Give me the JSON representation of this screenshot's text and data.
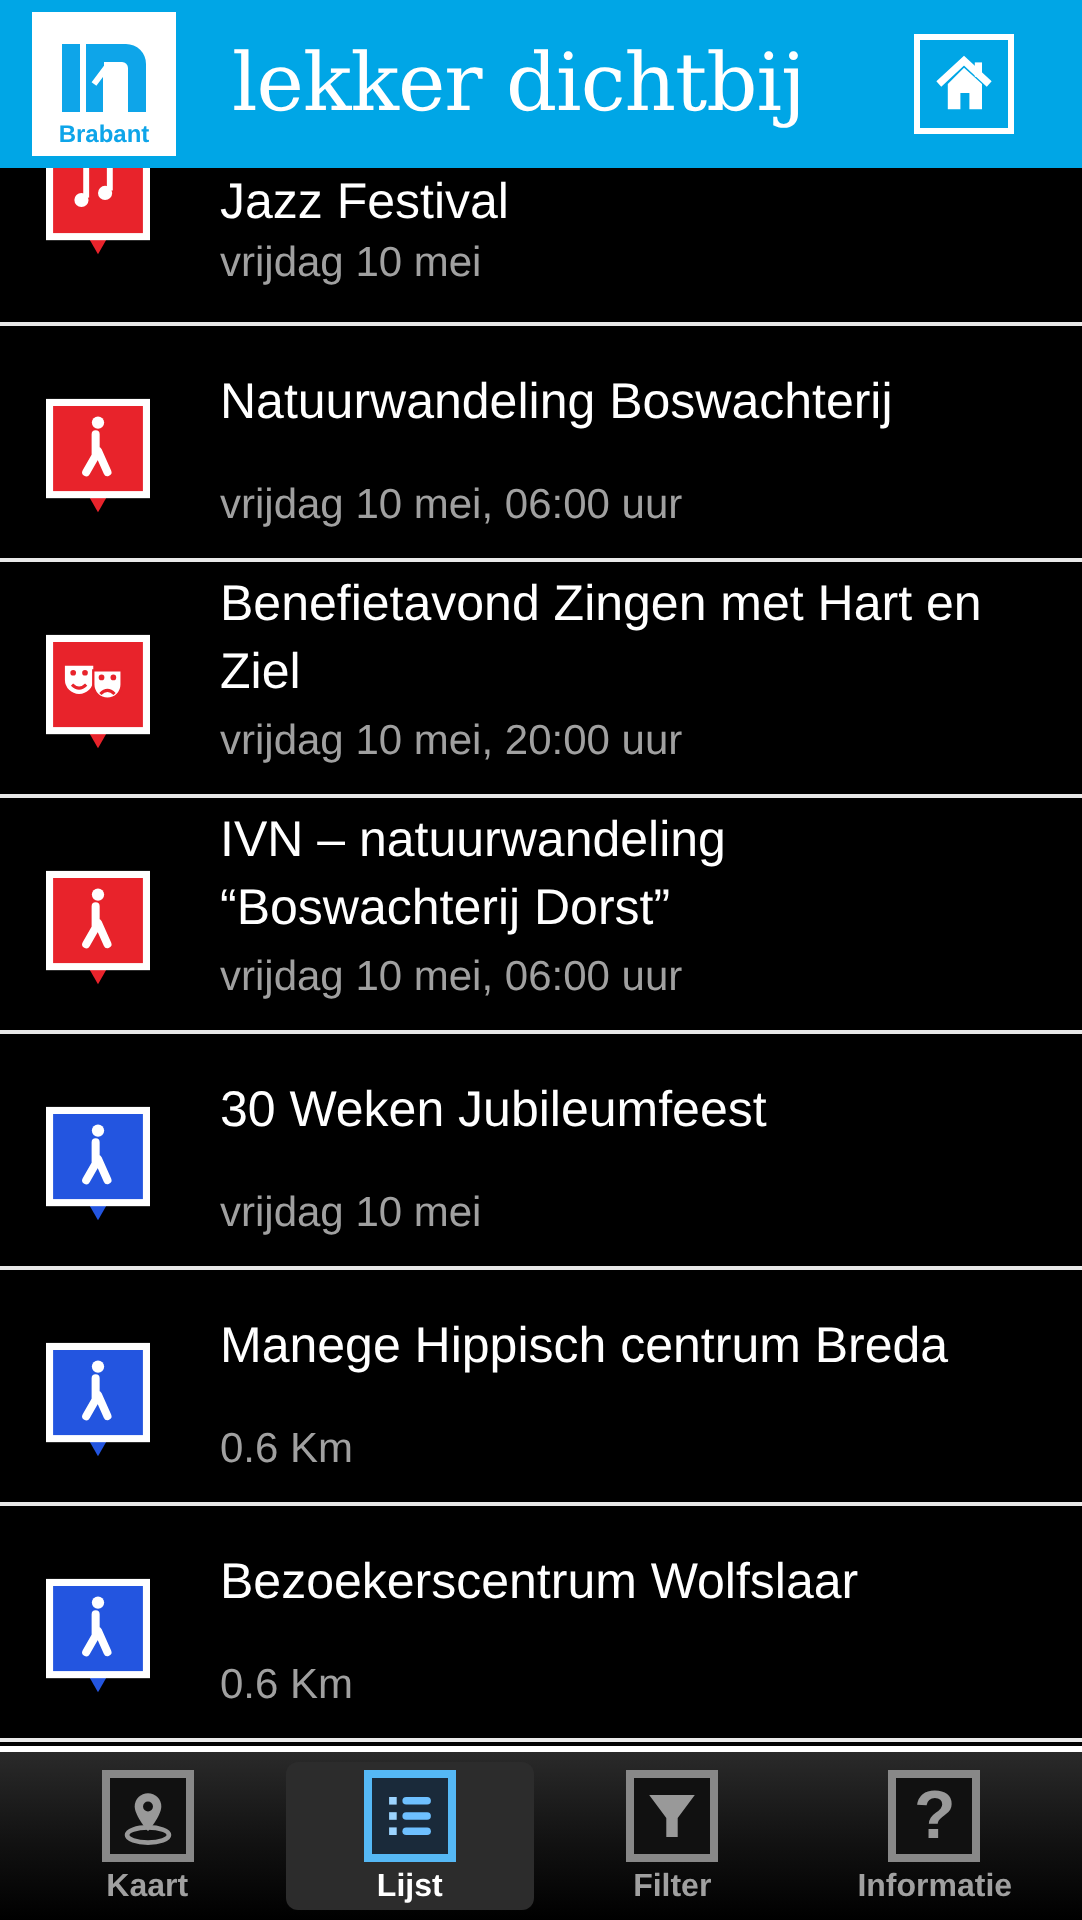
{
  "header": {
    "logo_text": "Brabant",
    "title": "lekker dichtbij"
  },
  "events": [
    {
      "kind": "music",
      "color": "#e8232b",
      "title": "Jazz Festival",
      "subtitle": "vrijdag 10 mei"
    },
    {
      "kind": "walk",
      "color": "#e8232b",
      "title": "Natuurwandeling Boswachterij",
      "subtitle": "vrijdag 10 mei, 06:00 uur"
    },
    {
      "kind": "theater",
      "color": "#e8232b",
      "title": "Benefietavond Zingen met Hart en Ziel",
      "subtitle": "vrijdag 10 mei, 20:00 uur"
    },
    {
      "kind": "walk",
      "color": "#e8232b",
      "title": "IVN – natuurwandeling “Boswachterij Dorst”",
      "subtitle": "vrijdag 10 mei, 06:00 uur"
    },
    {
      "kind": "walk",
      "color": "#2355e0",
      "title": "30 Weken Jubileumfeest",
      "subtitle": "vrijdag 10 mei"
    },
    {
      "kind": "walk",
      "color": "#2355e0",
      "title": "Manege Hippisch centrum Breda",
      "subtitle": "0.6 Km"
    },
    {
      "kind": "walk",
      "color": "#2355e0",
      "title": "Bezoekerscentrum Wolfslaar",
      "subtitle": "0.6 Km"
    }
  ],
  "tabs": [
    {
      "kind": "map",
      "label": "Kaart",
      "selected": false
    },
    {
      "kind": "list",
      "label": "Lijst",
      "selected": true
    },
    {
      "kind": "filter",
      "label": "Filter",
      "selected": false
    },
    {
      "kind": "info",
      "label": "Informatie",
      "selected": false,
      "glyph": "?"
    }
  ]
}
